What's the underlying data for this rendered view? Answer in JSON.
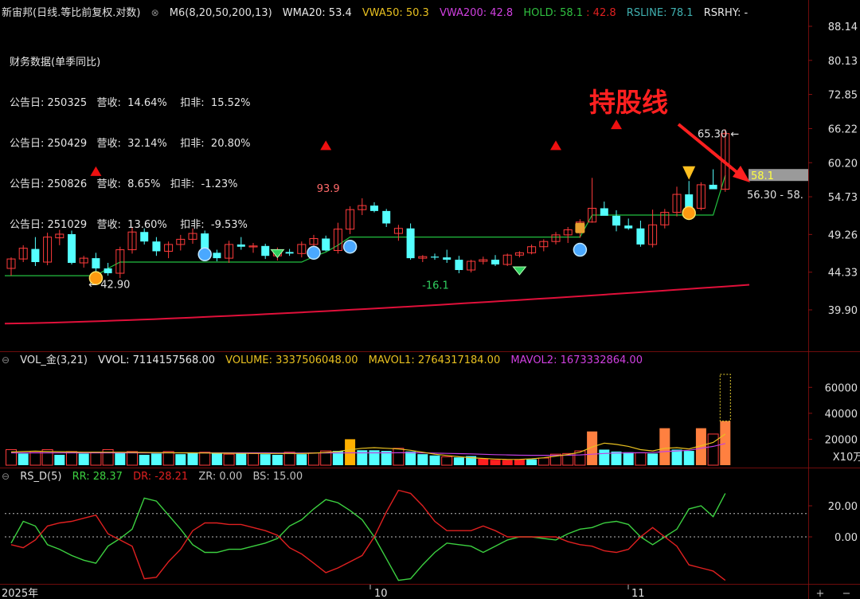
{
  "header": {
    "symbol": "新宙邦(日线.等比前复权.对数)",
    "indicator": "M6(8,20,50,200,13)",
    "wma20": "WMA20: 53.4",
    "vwa50": "VWA50: 50.3",
    "vwa200": "VWA200: 42.8",
    "hold": "HOLD: 58.1",
    "hold2": ": 42.8",
    "rsline": "RSLINE: 78.1",
    "rsrhy": "RSRHY: -"
  },
  "financial": {
    "title": "财务数据(单季同比)",
    "rows": [
      "公告日: 250325   营收:  14.64%    扣非:  15.52%",
      "公告日: 250429   营收:  32.14%    扣非:  20.80%",
      "公告日: 250826   营收:  8.65%   扣非:  -1.23%",
      "公告日: 251029   营收:  13.60%    扣非:  -9.53%"
    ]
  },
  "annotation": "持股线",
  "volume_header": {
    "name": "VOL_金(3,21)",
    "vvol": "VVOL: 7114157568.00",
    "volume": "VOLUME: 3337506048.00",
    "mavol1": "MAVOL1: 2764317184.00",
    "mavol2": "MAVOL2: 1673332864.00"
  },
  "rs_header": {
    "name": "RS_D(5)",
    "rr": "RR: 28.37",
    "dr": "DR: -28.21",
    "zr": "ZR: 0.00",
    "bs": "BS: 15.00"
  },
  "colors": {
    "up": "#ff3b3b",
    "down": "#54ffff",
    "hold": "#22c040",
    "ma": "#e0103a",
    "rr": "#3cd040",
    "dr": "#e02020",
    "vol_orange": "#ff8040",
    "vol_yellow": "#ffb000"
  },
  "chart_data": [
    {
      "type": "candlestick",
      "scale": "log",
      "y_ticks": [
        "88.14",
        "80.13",
        "72.85",
        "66.22",
        "60.20",
        "54.73",
        "49.26",
        "44.33",
        "39.90"
      ],
      "x_labels": [
        "2025年",
        "10",
        "11"
      ],
      "candles": [
        [
          44.8,
          46.2,
          43.9,
          46.0
        ],
        [
          46.0,
          47.8,
          45.6,
          47.4
        ],
        [
          47.3,
          48.9,
          45.1,
          45.6
        ],
        [
          45.6,
          49.5,
          45.2,
          48.9
        ],
        [
          48.8,
          49.9,
          47.8,
          49.3
        ],
        [
          49.3,
          49.8,
          45.3,
          45.5
        ],
        [
          45.5,
          46.4,
          44.9,
          46.1
        ],
        [
          46.1,
          46.8,
          44.2,
          44.8
        ],
        [
          44.8,
          45.5,
          43.9,
          44.2
        ],
        [
          44.2,
          47.6,
          43.6,
          47.2
        ],
        [
          47.2,
          50.3,
          46.7,
          49.6
        ],
        [
          49.6,
          50.1,
          47.9,
          48.3
        ],
        [
          48.3,
          48.9,
          46.4,
          47.0
        ],
        [
          47.0,
          48.3,
          46.1,
          47.9
        ],
        [
          47.9,
          49.2,
          47.1,
          48.6
        ],
        [
          48.6,
          50.1,
          48.0,
          49.4
        ],
        [
          49.4,
          49.8,
          46.5,
          46.8
        ],
        [
          46.8,
          47.2,
          45.7,
          46.1
        ],
        [
          46.1,
          48.4,
          45.5,
          47.9
        ],
        [
          47.9,
          48.9,
          47.2,
          47.6
        ],
        [
          47.6,
          48.1,
          46.8,
          47.7
        ],
        [
          47.7,
          48.0,
          46.0,
          46.4
        ],
        [
          46.4,
          47.5,
          45.8,
          46.9
        ],
        [
          46.9,
          47.3,
          46.4,
          46.7
        ],
        [
          46.7,
          48.3,
          46.2,
          47.9
        ],
        [
          47.9,
          49.2,
          47.6,
          48.7
        ],
        [
          48.7,
          49.1,
          47.0,
          47.1
        ],
        [
          47.1,
          50.9,
          46.7,
          50.0
        ],
        [
          50.0,
          53.3,
          49.3,
          52.8
        ],
        [
          52.8,
          54.5,
          52.0,
          53.4
        ],
        [
          53.4,
          53.9,
          52.4,
          52.6
        ],
        [
          52.6,
          52.9,
          50.3,
          50.8
        ],
        [
          49.4,
          50.6,
          48.4,
          50.1
        ],
        [
          50.1,
          50.8,
          45.9,
          46.1
        ],
        [
          46.1,
          46.5,
          45.6,
          46.3
        ],
        [
          46.3,
          46.7,
          45.9,
          46.2
        ],
        [
          46.2,
          47.2,
          45.5,
          45.9
        ],
        [
          45.9,
          46.4,
          44.2,
          44.6
        ],
        [
          44.6,
          45.9,
          44.3,
          45.7
        ],
        [
          45.7,
          46.3,
          45.3,
          45.9
        ],
        [
          45.9,
          46.5,
          45.1,
          45.3
        ],
        [
          45.3,
          46.7,
          45.1,
          46.5
        ],
        [
          46.5,
          47.0,
          46.2,
          46.8
        ],
        [
          46.8,
          47.9,
          46.6,
          47.6
        ],
        [
          47.6,
          48.6,
          47.0,
          48.3
        ],
        [
          48.3,
          49.6,
          47.9,
          49.2
        ],
        [
          49.2,
          50.3,
          48.1,
          49.9
        ],
        [
          49.9,
          51.4,
          48.8,
          51.0
        ],
        [
          51.0,
          57.7,
          50.9,
          53.0
        ],
        [
          53.0,
          54.0,
          52.0,
          51.9
        ],
        [
          51.9,
          52.7,
          49.7,
          50.5
        ],
        [
          50.5,
          51.5,
          49.9,
          50.1
        ],
        [
          50.1,
          51.2,
          47.6,
          47.9
        ],
        [
          47.9,
          52.8,
          47.5,
          50.6
        ],
        [
          50.6,
          52.9,
          50.1,
          52.4
        ],
        [
          52.4,
          56.3,
          51.8,
          55.1
        ],
        [
          55.1,
          57.2,
          52.6,
          53.0
        ],
        [
          53.0,
          57.0,
          52.7,
          56.6
        ],
        [
          56.6,
          59.1,
          56.2,
          55.9
        ],
        [
          55.9,
          66.1,
          55.5,
          65.3
        ]
      ],
      "hold_line": [
        43.9,
        43.9,
        43.9,
        43.9,
        43.9,
        43.9,
        43.9,
        43.9,
        44.8,
        45.6,
        45.6,
        45.6,
        45.6,
        45.6,
        45.6,
        45.6,
        45.6,
        45.6,
        45.6,
        45.6,
        45.6,
        45.6,
        45.6,
        45.6,
        45.6,
        46.3,
        46.9,
        47.8,
        48.9,
        48.9,
        48.9,
        48.9,
        48.9,
        48.9,
        48.9,
        48.9,
        48.9,
        48.9,
        48.9,
        48.9,
        48.9,
        48.9,
        48.9,
        48.9,
        48.9,
        48.9,
        48.9,
        48.9,
        52.0,
        52.0,
        52.0,
        52.0,
        52.0,
        52.0,
        52.0,
        52.0,
        52.0,
        52.0,
        52.0,
        58.1
      ],
      "ma200_start": 38.4,
      "ma200_end": 42.8,
      "triangles": [
        {
          "i": 7,
          "v": 58.8
        },
        {
          "i": 26,
          "v": 63.2
        },
        {
          "i": 45,
          "v": 63.2
        },
        {
          "i": 50,
          "v": 67.0
        }
      ],
      "labels": [
        {
          "text": "42.90",
          "i": 6,
          "v": 42.9
        },
        {
          "text": "93.9",
          "i": 26,
          "v": 54.6
        },
        {
          "text": "-16.1",
          "i": 35,
          "v": 43.3
        },
        {
          "text": "65.30",
          "i": 54,
          "v": 65.3
        },
        {
          "text": "56.30 - 58.",
          "i": 55,
          "v": 55.1
        }
      ],
      "hold_tag": "58.1"
    },
    {
      "type": "bar",
      "title": "VOL",
      "y_ticks": [
        "60000",
        "40000",
        "20000"
      ],
      "unit": "X10万",
      "values": [
        12000,
        9000,
        10500,
        12000,
        8000,
        10500,
        9000,
        10000,
        12000,
        9500,
        10500,
        8000,
        9000,
        10500,
        8500,
        9500,
        10000,
        9500,
        8500,
        9000,
        9000,
        8500,
        8000,
        10000,
        8500,
        9500,
        11000,
        11000,
        20000,
        11500,
        11500,
        11000,
        13000,
        10500,
        8500,
        7500,
        6500,
        6000,
        7000,
        5000,
        4200,
        4000,
        4500,
        4500,
        5500,
        8500,
        9000,
        11000,
        26000,
        12000,
        10500,
        10000,
        9500,
        9000,
        28500,
        12000,
        11000,
        28500,
        24000,
        34000
      ],
      "colors": [
        "u",
        "d",
        "u",
        "u",
        "d",
        "u",
        "d",
        "u",
        "u",
        "d",
        "u",
        "d",
        "d",
        "u",
        "d",
        "d",
        "u",
        "d",
        "u",
        "d",
        "u",
        "d",
        "d",
        "u",
        "d",
        "u",
        "u",
        "d",
        "y",
        "d",
        "d",
        "d",
        "u",
        "d",
        "d",
        "d",
        "u",
        "d",
        "d",
        "r",
        "r",
        "r",
        "r",
        "d",
        "u",
        "u",
        "u",
        "u",
        "o",
        "d",
        "d",
        "d",
        "u",
        "d",
        "o",
        "d",
        "d",
        "o",
        "u",
        "o"
      ],
      "mavol1": [
        10200,
        10500,
        10800,
        10500,
        10400,
        10200,
        10000,
        10000,
        10000,
        10000,
        9900,
        9800,
        9700,
        9600,
        9500,
        9500,
        9400,
        9300,
        9200,
        9100,
        9100,
        9000,
        9000,
        9000,
        9000,
        9300,
        9800,
        10500,
        12000,
        13000,
        13500,
        13000,
        12500,
        11500,
        10000,
        8500,
        7500,
        6500,
        5800,
        5200,
        4700,
        4400,
        4500,
        4900,
        5700,
        7000,
        8200,
        10000,
        14000,
        17000,
        16000,
        14500,
        12000,
        11000,
        13000,
        13500,
        12500,
        15000,
        17500,
        24000
      ],
      "mavol2": [
        9500,
        9500,
        9500,
        9500,
        9500,
        9500,
        9500,
        9500,
        9500,
        9500,
        9500,
        9500,
        9500,
        9500,
        9500,
        9500,
        9500,
        9500,
        9500,
        9500,
        9500,
        9500,
        9400,
        9400,
        9400,
        9400,
        9400,
        9400,
        9500,
        9500,
        9500,
        9500,
        9600,
        9600,
        9500,
        9300,
        9100,
        8900,
        8700,
        8400,
        8100,
        7900,
        7700,
        7600,
        7600,
        7600,
        7700,
        7900,
        8500,
        9000,
        9400,
        9500,
        9600,
        9700,
        10500,
        11000,
        11500,
        13000,
        14500,
        16700
      ]
    },
    {
      "type": "line",
      "title": "RS_D(5)",
      "y_ticks": [
        "20.00",
        "0.00"
      ],
      "series": [
        {
          "name": "RR",
          "values": [
            -4,
            10,
            7,
            -5,
            -8,
            -12,
            -15,
            -17,
            -6,
            -1,
            5,
            25,
            23,
            14,
            5,
            -5,
            -10,
            -10,
            -8,
            -8,
            -6,
            -4,
            -1,
            7,
            11,
            18,
            24,
            22,
            17,
            11,
            0,
            -14,
            -28,
            -27,
            -18,
            -10,
            -4,
            -5,
            -6,
            -10,
            -6,
            -2,
            0,
            0,
            -1,
            -2,
            2,
            5,
            6,
            9,
            10,
            8,
            0,
            -5,
            0,
            5,
            18,
            20,
            13,
            28
          ]
        },
        {
          "name": "DR",
          "values": [
            -5,
            -7,
            -2,
            7,
            9,
            10,
            12,
            14,
            2,
            -2,
            -6,
            -27,
            -26,
            -16,
            -8,
            4,
            9,
            9,
            8,
            8,
            6,
            4,
            1,
            -7,
            -11,
            -17,
            -23,
            -20,
            -16,
            -12,
            0,
            16,
            30,
            28,
            20,
            10,
            4,
            4,
            4,
            7,
            4,
            0,
            0,
            0,
            0,
            0,
            -3,
            -5,
            -6,
            -9,
            -10,
            -8,
            0,
            6,
            0,
            -6,
            -18,
            -20,
            -22,
            -28
          ]
        }
      ]
    }
  ]
}
